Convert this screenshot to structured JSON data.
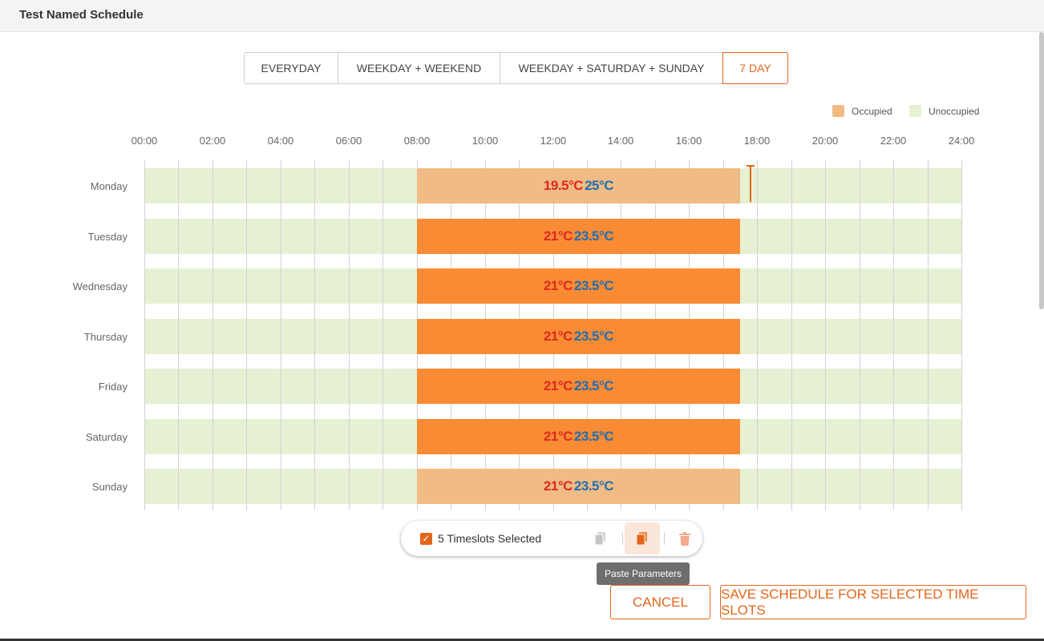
{
  "header": {
    "title": "Test Named Schedule"
  },
  "modes": {
    "items": [
      "EVERYDAY",
      "WEEKDAY + WEEKEND",
      "WEEKDAY + SATURDAY + SUNDAY",
      "7 DAY"
    ],
    "active": "7 DAY"
  },
  "legend": {
    "occupied": "Occupied",
    "unoccupied": "Unoccupied"
  },
  "hours": [
    "00:00",
    "02:00",
    "04:00",
    "06:00",
    "08:00",
    "10:00",
    "12:00",
    "14:00",
    "16:00",
    "18:00",
    "20:00",
    "22:00",
    "24:00"
  ],
  "schedule": [
    {
      "day": "Monday",
      "start": "08:00",
      "end": "17:30",
      "low": "19.5°C",
      "high": "25°C",
      "selected": false
    },
    {
      "day": "Tuesday",
      "start": "08:00",
      "end": "17:30",
      "low": "21°C",
      "high": "23.5°C",
      "selected": true
    },
    {
      "day": "Wednesday",
      "start": "08:00",
      "end": "17:30",
      "low": "21°C",
      "high": "23.5°C",
      "selected": true
    },
    {
      "day": "Thursday",
      "start": "08:00",
      "end": "17:30",
      "low": "21°C",
      "high": "23.5°C",
      "selected": true
    },
    {
      "day": "Friday",
      "start": "08:00",
      "end": "17:30",
      "low": "21°C",
      "high": "23.5°C",
      "selected": true
    },
    {
      "day": "Saturday",
      "start": "08:00",
      "end": "17:30",
      "low": "21°C",
      "high": "23.5°C",
      "selected": true
    },
    {
      "day": "Sunday",
      "start": "08:00",
      "end": "17:30",
      "low": "21°C",
      "high": "23.5°C",
      "selected": false
    }
  ],
  "colors": {
    "accent": "#e3651c",
    "occupied_light": "#f0bb84",
    "occupied_selected": "#f98b35",
    "unoccupied": "#e6f0d3",
    "temp_low": "#dd2a1e",
    "temp_high": "#1f6eb1"
  },
  "selection_bar": {
    "checked": true,
    "label": "5 Timeslots Selected",
    "icons": [
      "copy-icon",
      "paste-icon",
      "trash-icon"
    ]
  },
  "tooltip": "Paste Parameters",
  "footer": {
    "cancel": "CANCEL",
    "save": "SAVE SCHEDULE FOR SELECTED TIME SLOTS"
  }
}
